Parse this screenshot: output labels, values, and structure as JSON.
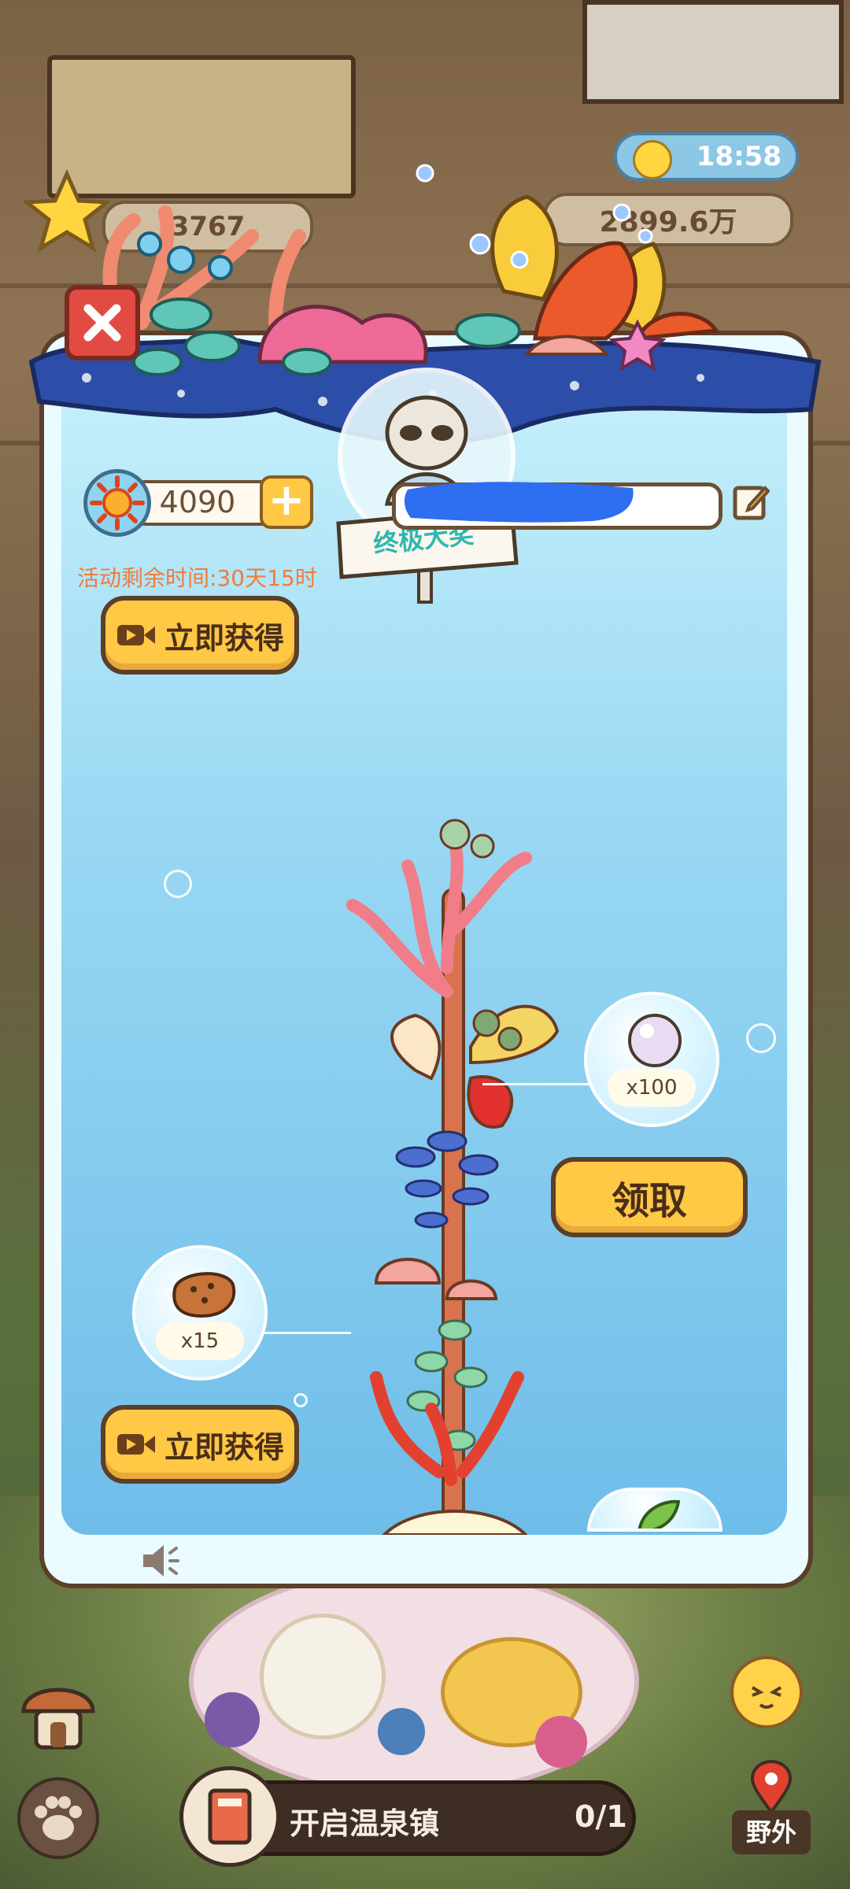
{
  "hud": {
    "time": "18:58",
    "money": "2899.6万",
    "stars": "3767"
  },
  "modal": {
    "sun_currency_value": "4090",
    "player_name_value": "",
    "badge_label": "终极大奖",
    "countdown": "活动剩余时间:30天15时",
    "get_now_top_label": "立即获得",
    "get_now_bottom_label": "立即获得",
    "claim_label": "领取",
    "reward_pearl_count": "x100",
    "reward_food_count": "x15"
  },
  "bottom": {
    "quest_text": "开启温泉镇",
    "quest_progress": "0/1",
    "wild_label": "野外"
  },
  "colors": {
    "button_yellow": "#ffc845",
    "button_border": "#5b3f2a",
    "close_red": "#e24b43",
    "sea_top": "#c8f1fb",
    "sea_bottom": "#6ebde9",
    "countdown_orange": "#ef7c3c",
    "badge_teal": "#2fb7b0"
  },
  "icons": {
    "close": "close-icon",
    "sun": "sun-icon",
    "plus": "plus-icon",
    "edit": "edit-icon",
    "video": "video-icon",
    "sound": "speaker-icon",
    "pearl": "pearl-icon",
    "food": "cookie-icon",
    "map_pin": "map-pin-icon",
    "paw": "paw-icon"
  }
}
